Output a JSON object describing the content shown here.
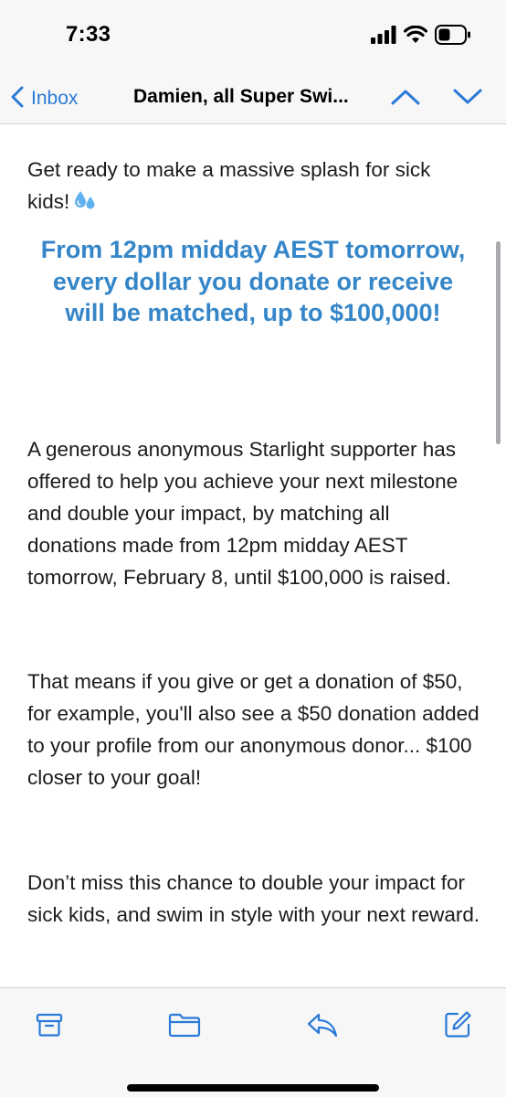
{
  "status_bar": {
    "time": "7:33",
    "icons": [
      "cellular-signal-icon",
      "wifi-icon",
      "battery-icon"
    ]
  },
  "nav": {
    "back_label": "Inbox",
    "title": "Damien, all Super Swi...",
    "icons": [
      "chevron-left-icon",
      "chevron-up-icon",
      "chevron-down-icon"
    ]
  },
  "message": {
    "intro": "Get ready to make a massive splash for sick kids!",
    "intro_emoji": "sweat-droplets-icon",
    "headline": "From 12pm midday AEST tomorrow, every dollar you donate or receive will be matched, up to $100,000!",
    "paragraph1": "A generous anonymous Starlight supporter has offered to help you achieve your next milestone and double your impact, by matching all donations made from 12pm midday AEST tomorrow, February 8, until $100,000 is raised.",
    "paragraph2": "That means if you give or get a donation of $50, for example, you'll also see a $50 donation added to your profile from our anonymous donor... $100 closer to your goal!",
    "paragraph3": "Don’t miss this chance to double your impact for sick kids, and swim in style with your next reward."
  },
  "toolbar": {
    "icons": [
      "archive-icon",
      "folder-icon",
      "reply-icon",
      "compose-icon"
    ]
  },
  "colors": {
    "accent": "#2a7ad8",
    "headline": "#3586c8",
    "bar_background": "#f7f7f7",
    "text": "#1c1c1e"
  }
}
